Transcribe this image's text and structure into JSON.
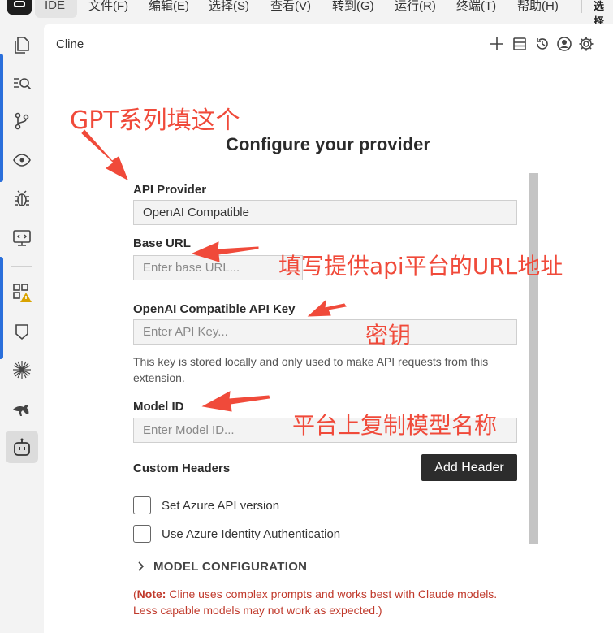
{
  "menubar": {
    "ide_label": "IDE",
    "items": [
      "文件(F)",
      "编辑(E)",
      "选择(S)",
      "查看(V)",
      "转到(G)",
      "运行(R)",
      "终端(T)",
      "帮助(H)"
    ],
    "right_label": "选择"
  },
  "activity_bar": {
    "icons": [
      "files-icon",
      "search-icon",
      "source-control-icon",
      "eye-icon",
      "debug-icon",
      "remote-icon",
      "extensions-icon",
      "bookmark-icon",
      "sparkle-icon",
      "kangaroo-icon",
      "robot-icon"
    ],
    "active": "robot-icon",
    "badge": "warning"
  },
  "panel": {
    "title": "Cline",
    "toolbar_icons": [
      "plus-icon",
      "history-list-icon",
      "history-icon",
      "account-icon",
      "settings-icon"
    ]
  },
  "form": {
    "heading": "Configure your provider",
    "api_provider_label": "API Provider",
    "api_provider_value": "OpenAI Compatible",
    "base_url_label": "Base URL",
    "base_url_placeholder": "Enter base URL...",
    "api_key_label": "OpenAI Compatible API Key",
    "api_key_placeholder": "Enter API Key...",
    "api_key_hint": "This key is stored locally and only used to make API requests from this extension.",
    "model_id_label": "Model ID",
    "model_id_placeholder": "Enter Model ID...",
    "custom_headers_label": "Custom Headers",
    "add_header_button": "Add Header",
    "azure_version_label": "Set Azure API version",
    "azure_identity_label": "Use Azure Identity Authentication",
    "model_config_label": "MODEL CONFIGURATION",
    "note_prefix": "Note:",
    "note_text": " Cline uses complex prompts and works best with Claude models. Less capable models may not work as expected.)",
    "note_open_paren": "("
  },
  "annotations": {
    "gpt": "GPT系列填这个",
    "url": "填写提供api平台的URL地址",
    "key": "密钥",
    "model": "平台上复制模型名称",
    "color": "#f04a3a"
  }
}
